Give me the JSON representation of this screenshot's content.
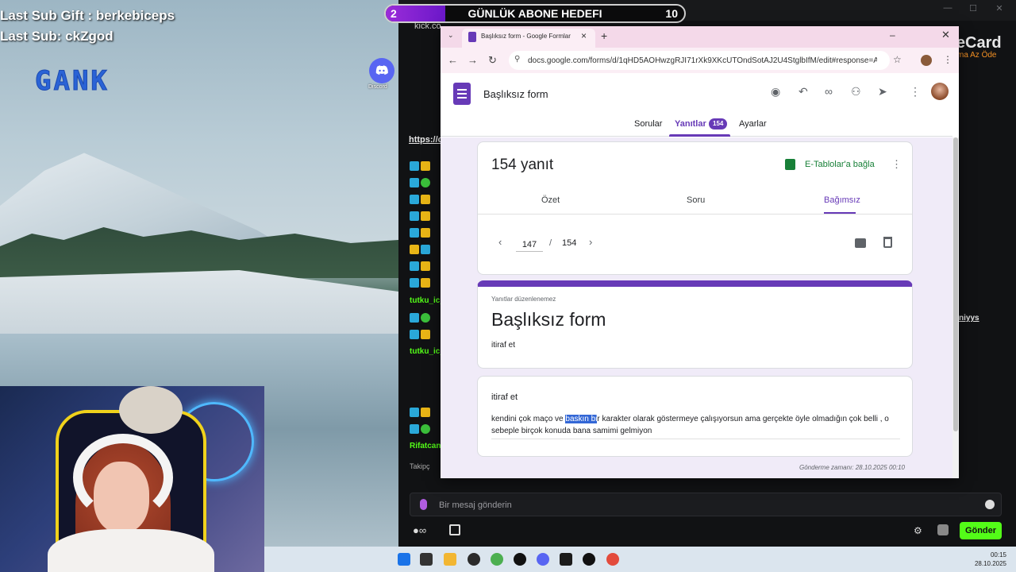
{
  "stream": {
    "last_sub_gift": "Last Sub Gift : berkebiceps",
    "last_sub": "Last Sub: ckZgod",
    "logo_text": "GANK",
    "discord_label": "Discord"
  },
  "kick": {
    "tab_text": "kick.co",
    "goal": {
      "current": "2",
      "title": "GÜNLÜK ABONE HEDEFI",
      "target": "10",
      "progress": 0.2
    },
    "pinned_link": "https://c",
    "chat_names": [
      "tutku_ic_",
      "tutku_ic_",
      "Rifatcan"
    ],
    "chat_right_link": "niyys",
    "followers_label": "Takipç",
    "chat_placeholder": "Bir mesaj gönderin",
    "send_label": "Gönder",
    "likecard_name": "LikeCard",
    "likecard_tag": "Oyna  Az Öde"
  },
  "chrome": {
    "tab_title": "Başlıksız form - Google Formlar",
    "url": "docs.google.com/forms/d/1qHD5AOHwzgRJI71rXk9XKcUTOndSotAJ2U4StglbIfM/edit#response=A..."
  },
  "forms": {
    "form_name": "Başlıksız form",
    "tabs": {
      "questions": "Sorular",
      "responses": "Yanıtlar",
      "settings": "Ayarlar"
    },
    "response_badge": "154",
    "response_count": "154 yanıt",
    "sheets_link": "E-Tablolar'a bağla",
    "sub_tabs": {
      "summary": "Özet",
      "question": "Soru",
      "individual": "Bağımsız"
    },
    "pager": {
      "current": "147",
      "sep": "/",
      "total": "154"
    },
    "read_only_note": "Yanıtlar düzenlenemez",
    "title": "Başlıksız form",
    "description": "itiraf et",
    "question": "itiraf et",
    "answer_before": "kendini çok maço ve ",
    "answer_selected": "baskın bi",
    "answer_after": "r karakter olarak göstermeye çalışıyorsun ama gerçekte öyle olmadığın çok belli , o sebeple birçok konuda bana samimi gelmiyon",
    "submitted_at": "Gönderme zamanı: 28.10.2025 00:10"
  },
  "taskbar": {
    "time": "00:15",
    "date": "28.10.2025"
  },
  "colors": {
    "forms_purple": "#673ab7",
    "kick_green": "#53fc18",
    "sheets_green": "#188038"
  }
}
